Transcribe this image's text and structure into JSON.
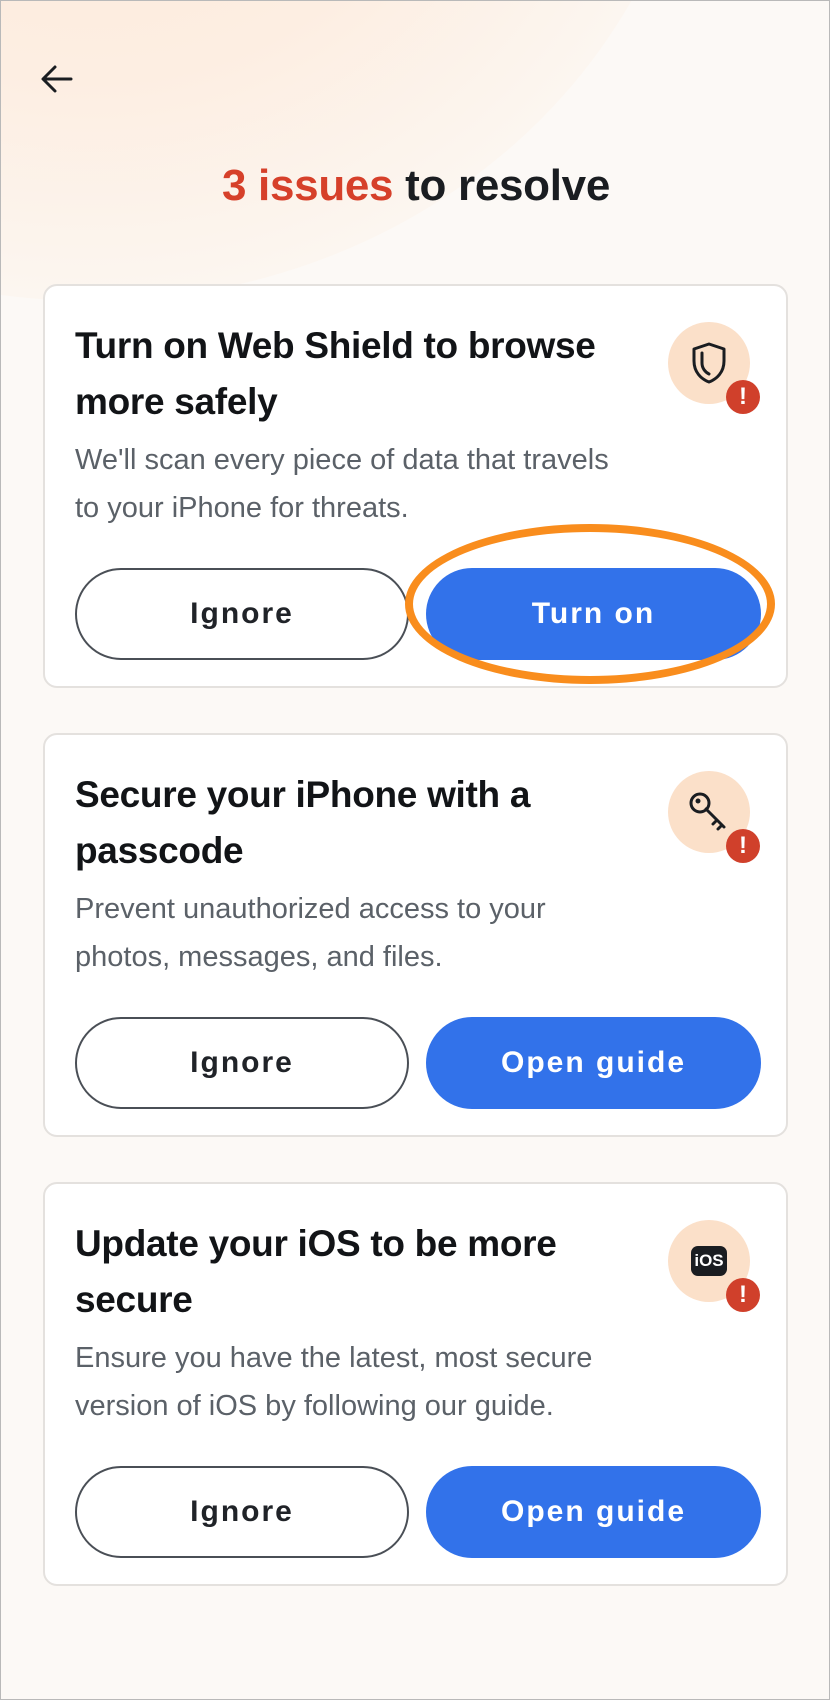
{
  "header": {
    "title_highlight": "3 issues",
    "title_rest": " to resolve"
  },
  "colors": {
    "accent_blue": "#3272ea",
    "issue_red": "#d6402a",
    "highlight_orange": "#f98d1d",
    "icon_bg": "#fbe0c9"
  },
  "cards": [
    {
      "title": "Turn on Web Shield to browse more safely",
      "description": "We'll scan every piece of data that travels to your iPhone for threats.",
      "icon": "shield-icon",
      "ignore_label": "Ignore",
      "action_label": "Turn on"
    },
    {
      "title": "Secure your iPhone with a passcode",
      "description": "Prevent unauthorized access to your photos, messages, and files.",
      "icon": "key-icon",
      "ignore_label": "Ignore",
      "action_label": "Open guide"
    },
    {
      "title": "Update your iOS to be more secure",
      "description": "Ensure you have the latest, most secure version of iOS by following our guide.",
      "icon": "ios-icon",
      "icon_text": "iOS",
      "ignore_label": "Ignore",
      "action_label": "Open guide"
    }
  ],
  "alert_symbol": "!"
}
